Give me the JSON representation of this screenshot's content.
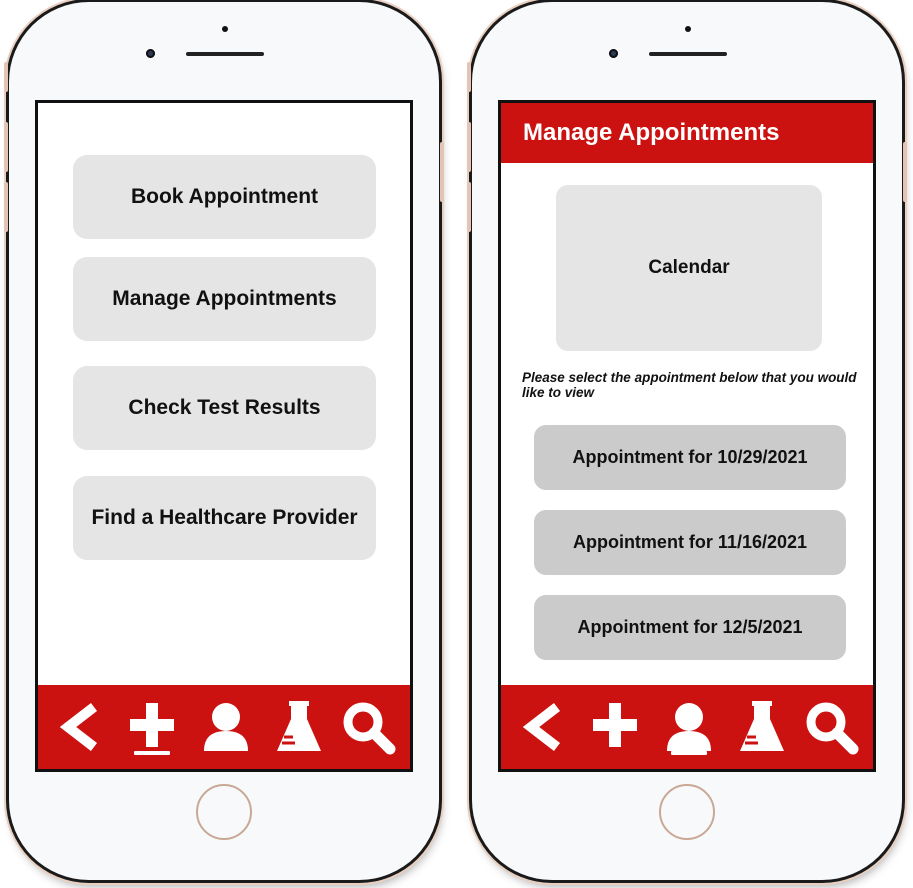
{
  "left_screen": {
    "menu": [
      {
        "label": "Book Appointment"
      },
      {
        "label": "Manage Appointments"
      },
      {
        "label": "Check Test Results"
      },
      {
        "label": "Find a Healthcare Provider"
      }
    ],
    "active_nav": "add"
  },
  "right_screen": {
    "header_title": "Manage Appointments",
    "calendar_label": "Calendar",
    "instruction": "Please select the appointment below that you would like to view",
    "appointments": [
      {
        "label": "Appointment for 10/29/2021"
      },
      {
        "label": "Appointment for 11/16/2021"
      },
      {
        "label": "Appointment for 12/5/2021"
      }
    ],
    "active_nav": "profile"
  },
  "nav_icons": [
    "back-icon",
    "plus-icon",
    "person-icon",
    "flask-icon",
    "search-icon"
  ],
  "colors": {
    "accent": "#cc1111",
    "menu_button": "#e5e5e5",
    "appointment_button": "#cbcbcb",
    "phone_frame": "#e8cfc0"
  }
}
